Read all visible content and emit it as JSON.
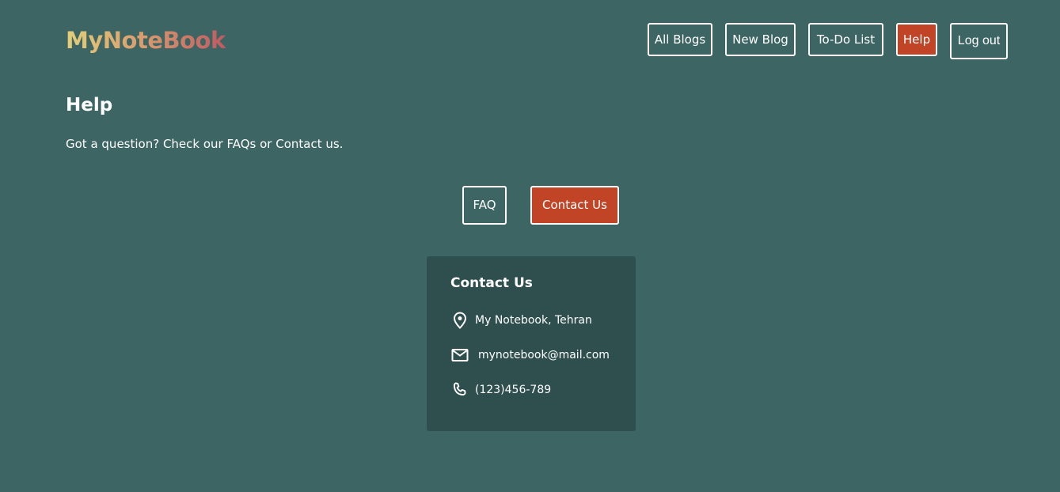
{
  "brand": {
    "name": "MyNoteBook"
  },
  "nav": {
    "items": [
      {
        "label": "All Blogs"
      },
      {
        "label": "New Blog"
      },
      {
        "label": "To-Do List"
      },
      {
        "label": "Help",
        "active": true
      },
      {
        "label": "Log out"
      }
    ]
  },
  "main": {
    "title": "Help",
    "description": "Got a question? Check our FAQs or Contact us.",
    "tabs": [
      {
        "label": "FAQ"
      },
      {
        "label": "Contact Us",
        "active": true
      }
    ]
  },
  "contact": {
    "title": "Contact Us",
    "address": "My Notebook, Tehran",
    "email": "mynotebook@mail.com",
    "phone": "(123)456-789",
    "icons": {
      "address": "location-pin-icon",
      "email": "mail-icon",
      "phone": "phone-icon"
    }
  },
  "colors": {
    "background": "#3c6563",
    "card": "#2e4f4e",
    "accent": "#c24426",
    "logo_gradient": [
      "#e4cf78",
      "#d89a6e",
      "#c05a62"
    ]
  }
}
